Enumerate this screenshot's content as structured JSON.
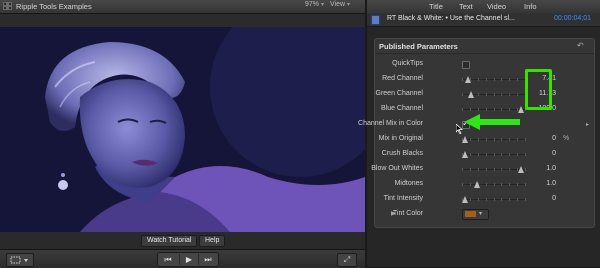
{
  "viewer": {
    "title": "Ripple Tools Examples",
    "zoom": "97%",
    "view_menu_label": "View",
    "watch_tutorial_label": "Watch Tutorial",
    "help_label": "Help",
    "transport_icons": [
      "previous-icon",
      "play-icon",
      "next-icon"
    ]
  },
  "inspector": {
    "tabs": [
      "Title",
      "Text",
      "Video",
      "Info"
    ],
    "effect_name": "RT Black & White: • Use the Channel sl...",
    "timecode": "00:00:04;01",
    "section_title": "Published Parameters",
    "parameters": [
      {
        "label": "QuickTips",
        "type": "checkbox",
        "checked": false
      },
      {
        "label": "Red Channel",
        "type": "slider",
        "value": "7.41",
        "level": 0.06
      },
      {
        "label": "Green Channel",
        "type": "slider",
        "value": "11.73",
        "level": 0.1
      },
      {
        "label": "Blue Channel",
        "type": "slider",
        "value": "100.0",
        "level": 0.96
      },
      {
        "label": "Channel Mix in Color",
        "type": "checkbox",
        "checked": true
      },
      {
        "label": "Mix in Original",
        "type": "slider",
        "value": "0",
        "unit": "%",
        "level": 0.0
      },
      {
        "label": "Crush Blacks",
        "type": "slider",
        "value": "0",
        "level": 0.0
      },
      {
        "label": "Blow Out Whites",
        "type": "slider",
        "value": "1.0",
        "level": 0.96
      },
      {
        "label": "Midtones",
        "type": "slider",
        "value": "1.0",
        "level": 0.2
      },
      {
        "label": "Tint Intensity",
        "type": "slider",
        "value": "0",
        "level": 0.0
      },
      {
        "label": "Tint Color",
        "type": "color",
        "color": "#a55f1d"
      }
    ]
  },
  "colors": {
    "accent_timecode": "#3d8cff",
    "highlight": "#39e000",
    "arrow": "#2ee51a"
  }
}
